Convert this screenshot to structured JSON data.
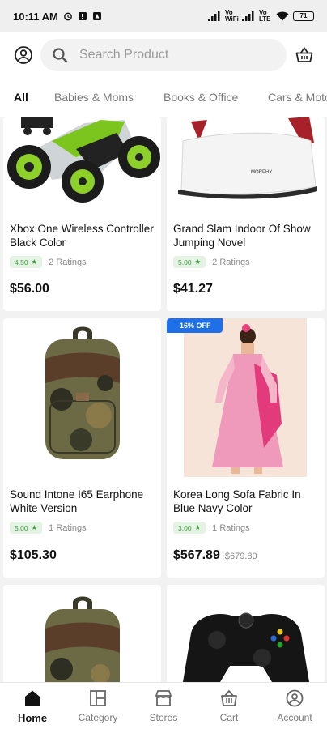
{
  "status": {
    "time": "10:11 AM",
    "battery": "71",
    "net1": "Vo WiFi",
    "net2": "Vo LTE"
  },
  "search": {
    "placeholder": "Search Product"
  },
  "tabs": [
    "All",
    "Babies & Moms",
    "Books & Office",
    "Cars & Motors"
  ],
  "products": [
    {
      "title": "Xbox One Wireless Controller Black Color",
      "rating": "4.50",
      "ratings_text": "2 Ratings",
      "price": "$56.00",
      "image": "rc-stunt-car"
    },
    {
      "title": "Grand Slam Indoor Of Show Jumping Novel",
      "rating": "5.00",
      "ratings_text": "2 Ratings",
      "price": "$41.27",
      "image": "steam-iron",
      "image_brand": "MORPHY"
    },
    {
      "title": "Sound Intone I65 Earphone White Version",
      "rating": "5.00",
      "ratings_text": "1 Ratings",
      "price": "$105.30",
      "image": "camo-backpack"
    },
    {
      "title": "Korea Long Sofa Fabric In Blue Navy Color",
      "rating": "3.00",
      "ratings_text": "1 Ratings",
      "price": "$567.89",
      "old_price": "$679.80",
      "badge": "16% OFF",
      "image": "girl-pink-dress"
    },
    {
      "image": "camo-backpack"
    },
    {
      "image": "xbox-controller"
    }
  ],
  "nav": [
    {
      "label": "Home",
      "icon": "home-icon"
    },
    {
      "label": "Category",
      "icon": "category-icon"
    },
    {
      "label": "Stores",
      "icon": "store-icon"
    },
    {
      "label": "Cart",
      "icon": "cart-icon"
    },
    {
      "label": "Account",
      "icon": "account-icon"
    }
  ],
  "colors": {
    "accent": "#1e6fe8",
    "rating_bg": "#e5f3e5",
    "rating_fg": "#3a9a3a",
    "page_bg": "#f2f2f2"
  }
}
